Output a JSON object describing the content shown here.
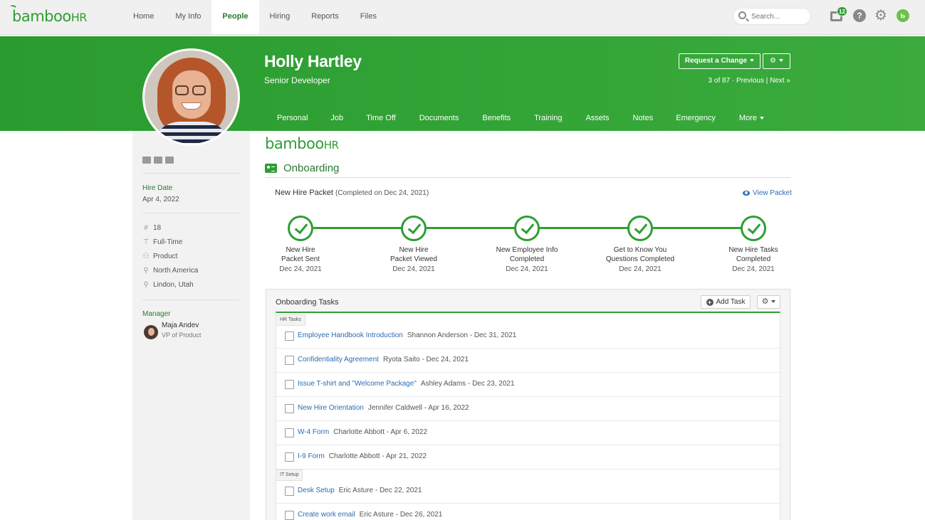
{
  "topnav": {
    "logo_text": "bamboo",
    "logo_hr": "HR",
    "items": [
      "Home",
      "My Info",
      "People",
      "Hiring",
      "Reports",
      "Files"
    ],
    "active_item": "People",
    "search_placeholder": "Search...",
    "inbox_badge": "12",
    "help_glyph": "?",
    "icons": [
      "search-icon",
      "inbox-icon",
      "help-icon",
      "gear-icon",
      "user-circle-icon"
    ]
  },
  "header": {
    "name": "Holly Hartley",
    "title": "Senior Developer",
    "request_change_label": "Request a Change",
    "pager_position": "3 of 87 ·",
    "pager_previous": "Previous",
    "pager_next": "Next »",
    "tabs": [
      "Personal",
      "Job",
      "Time Off",
      "Documents",
      "Benefits",
      "Training",
      "Assets",
      "Notes",
      "Emergency",
      "More"
    ],
    "colors": {
      "header_green": "#2e9e32",
      "active_nav": "#2a7a2d"
    }
  },
  "sidebar": {
    "social_icons": [
      "email-icon",
      "linkedin-icon",
      "twitter-icon"
    ],
    "hire_date_label": "Hire Date",
    "hire_date": "Apr 4, 2022",
    "details": [
      {
        "icon": "hash-icon",
        "glyph": "#",
        "text": "18"
      },
      {
        "icon": "briefcase-icon",
        "glyph": "⊤",
        "text": "Full-Time"
      },
      {
        "icon": "people-icon",
        "glyph": "⚇",
        "text": "Product"
      },
      {
        "icon": "org-chart-icon",
        "glyph": "⚲",
        "text": "North America"
      },
      {
        "icon": "location-pin-icon",
        "glyph": "⚲",
        "text": "Lindon, Utah"
      }
    ],
    "manager_label": "Manager",
    "manager_name": "Maja Andev",
    "manager_title": "VP of Product"
  },
  "main": {
    "brand_text": "bamboo",
    "brand_hr": "HR",
    "section_title": "Onboarding",
    "packet_title": "New Hire Packet",
    "packet_sub": "(Completed on Dec 24, 2021)",
    "view_packet": "View Packet",
    "steps": [
      {
        "label": "New Hire\nPacket Sent",
        "date": "Dec 24, 2021",
        "status": "complete"
      },
      {
        "label": "New Hire\nPacket Viewed",
        "date": "Dec 24, 2021",
        "status": "complete"
      },
      {
        "label": "New Employee Info\nCompleted",
        "date": "Dec 24, 2021",
        "status": "complete"
      },
      {
        "label": "Get to Know You\nQuestions Completed",
        "date": "Dec 24, 2021",
        "status": "complete"
      },
      {
        "label": "New Hire Tasks\nCompleted",
        "date": "Dec 24, 2021",
        "status": "complete"
      }
    ]
  },
  "tasks": {
    "title": "Onboarding Tasks",
    "add_task_label": "Add Task",
    "groups": [
      {
        "name": "HR Tasks",
        "items": [
          {
            "name": "Employee Handbook Introduction",
            "meta": "Shannon Anderson - Dec 31, 2021"
          },
          {
            "name": "Confidentiality Agreement",
            "meta": "Ryota Saito - Dec 24, 2021"
          },
          {
            "name": "Issue T-shirt and \"Welcome Package\"",
            "meta": "Ashley Adams - Dec 23, 2021"
          },
          {
            "name": "New Hire Orientation",
            "meta": "Jennifer Caldwell - Apr 16, 2022"
          },
          {
            "name": "W-4 Form",
            "meta": "Charlotte Abbott - Apr 6, 2022"
          },
          {
            "name": "I-9 Form",
            "meta": "Charlotte Abbott - Apr 21, 2022"
          }
        ]
      },
      {
        "name": "IT Setup",
        "items": [
          {
            "name": "Desk Setup",
            "meta": "Eric Asture - Dec 22, 2021"
          },
          {
            "name": "Create work email",
            "meta": "Eric Asture - Dec 26, 2021"
          }
        ]
      }
    ]
  }
}
